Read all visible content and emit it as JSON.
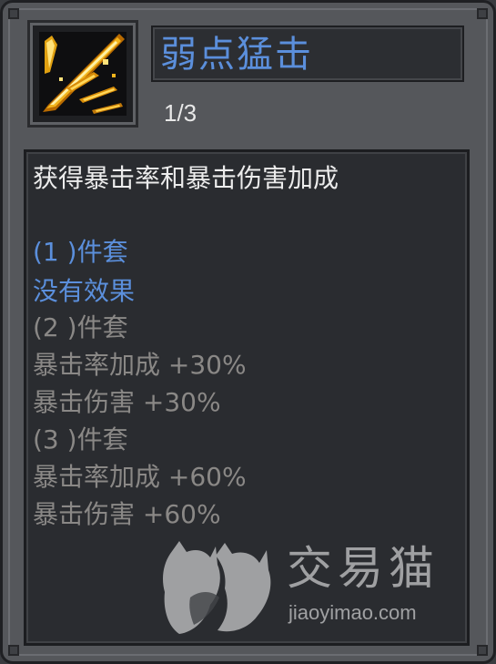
{
  "skill": {
    "name": "弱点猛击",
    "level": "1/3",
    "icon": "golden-slash-icon"
  },
  "description": {
    "summary": "获得暴击率和暴击伤害加成",
    "tiers": [
      {
        "header": "(1 )件套",
        "effects": [
          "没有效果"
        ],
        "active": true
      },
      {
        "header": "(2 )件套",
        "effects": [
          "暴击率加成 +30%",
          "暴击伤害 +30%"
        ],
        "active": false
      },
      {
        "header": "(3 )件套",
        "effects": [
          "暴击率加成 +60%",
          "暴击伤害 +60%"
        ],
        "active": false
      }
    ]
  },
  "watermark": {
    "brand_cn": "交易猫",
    "brand_url": "jiaoyimao.com",
    "logo": "cat-logo-icon"
  },
  "colors": {
    "name_blue": "#5b8fdc",
    "active_tier": "#5b8fdc",
    "inactive_tier": "#8a8886",
    "summary_text": "#ececec",
    "panel_bg": "#55575b",
    "box_bg": "#2a2c30"
  }
}
